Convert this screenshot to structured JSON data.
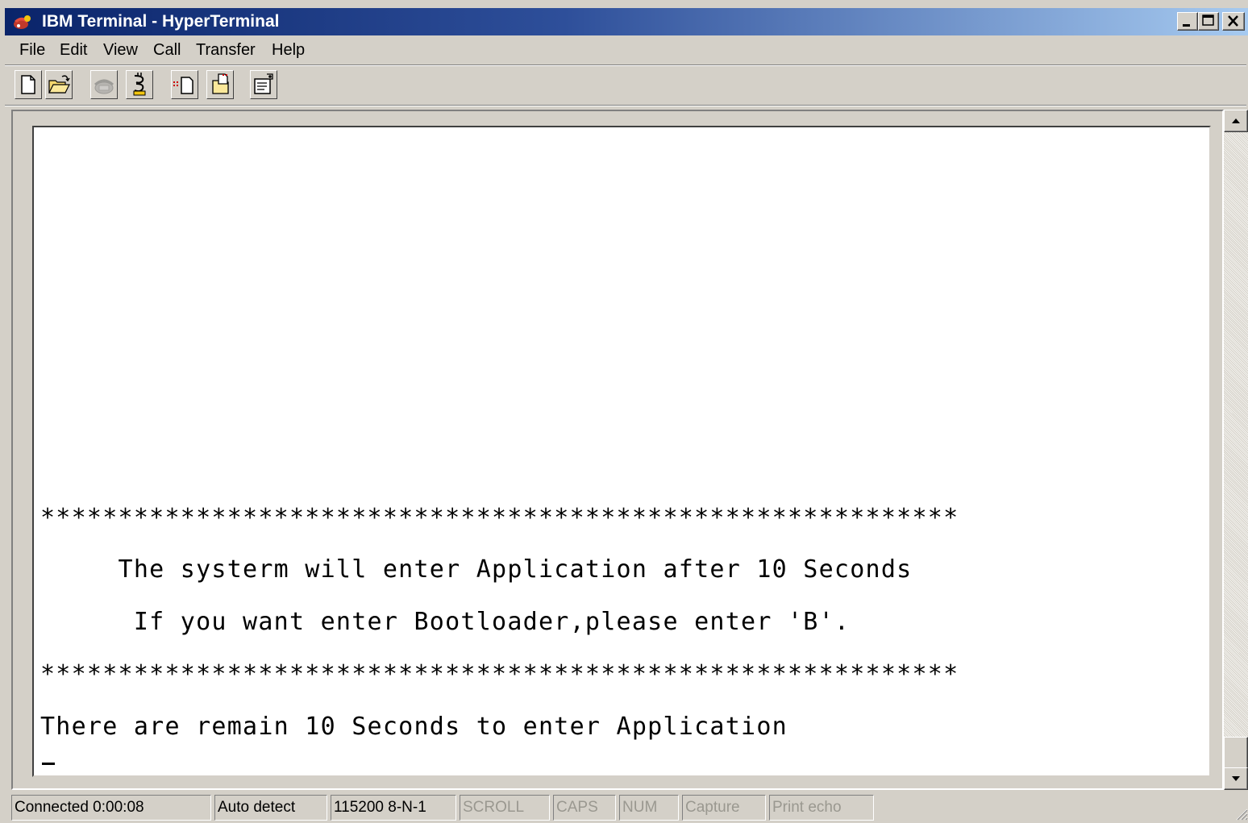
{
  "window": {
    "title": "IBM Terminal - HyperTerminal",
    "title_icon": "hyperterminal-phone-icon",
    "controls": [
      "minimize-icon",
      "maximize-icon",
      "close-icon"
    ]
  },
  "menu": [
    "File",
    "Edit",
    "View",
    "Call",
    "Transfer",
    "Help"
  ],
  "toolbar": {
    "buttons": [
      {
        "icon": "new-document-icon",
        "enabled": true
      },
      {
        "icon": "open-folder-icon",
        "enabled": true
      },
      {
        "icon": "connect-phone-icon",
        "enabled": false
      },
      {
        "icon": "disconnect-icon",
        "enabled": true
      },
      {
        "icon": "send-file-icon",
        "enabled": true
      },
      {
        "icon": "receive-file-icon",
        "enabled": true
      },
      {
        "icon": "properties-icon",
        "enabled": true
      }
    ]
  },
  "terminal": {
    "lines": [
      {
        "text": "***********************************************************"
      },
      {
        "text": "     The systerm will enter Application after 10 Seconds"
      },
      {
        "text": "      If you want enter Bootloader,please enter 'B'."
      },
      {
        "text": "***********************************************************"
      },
      {
        "text": "There are remain 10 Seconds to enter Application"
      }
    ]
  },
  "statusbar": {
    "connection": "Connected 0:00:08",
    "emulation": "Auto detect",
    "settings": "115200 8-N-1",
    "scroll": "SCROLL",
    "caps": "CAPS",
    "num": "NUM",
    "capture": "Capture",
    "print_echo": "Print echo"
  },
  "colors": {
    "title_gradient_start": "#0a246a",
    "title_gradient_end": "#a6caf0",
    "face": "#d4d0c8",
    "terminal_bg": "#ffffff",
    "terminal_text": "#000000"
  }
}
